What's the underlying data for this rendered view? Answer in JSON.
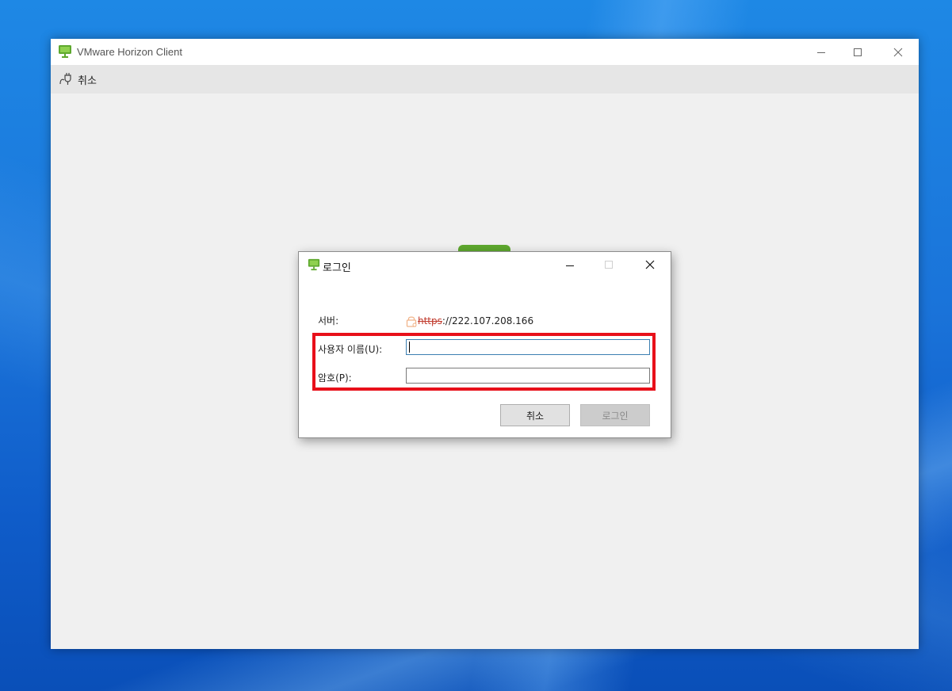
{
  "main_window": {
    "title": "VMware Horizon Client",
    "toolbar": {
      "cancel_label": "취소"
    }
  },
  "login_dialog": {
    "title": "로그인",
    "server_label": "서버:",
    "server_protocol": "https",
    "server_rest": "://222.107.208.166",
    "username_label": "사용자 이름(U):",
    "username_value": "",
    "password_label": "암호(P):",
    "password_value": "",
    "cancel_button": "취소",
    "login_button": "로그인"
  },
  "colors": {
    "accent_green": "#5ea82e",
    "highlight_red": "#e8101a",
    "desktop_blue": "#1a73d9"
  },
  "icons": [
    "horizon-monitor-icon",
    "minimize-icon",
    "maximize-icon",
    "close-icon",
    "disconnect-plug-icon",
    "lock-icon"
  ]
}
